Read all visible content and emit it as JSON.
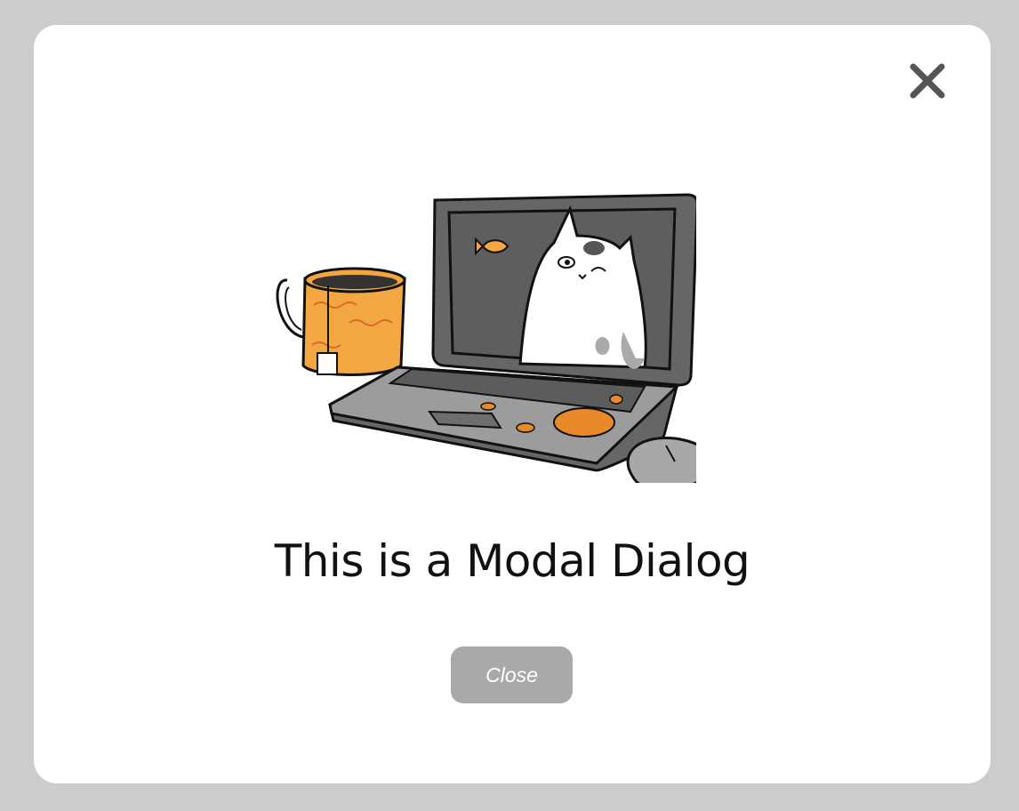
{
  "modal": {
    "title": "This is a Modal Dialog",
    "close_button_label": "Close"
  },
  "icons": {
    "close": "close-icon",
    "illustration": "laptop-cat-illustration"
  },
  "colors": {
    "overlay": "#cccccc",
    "modal_background": "#ffffff",
    "button_background": "#a9a9a9",
    "button_text": "#ffffff",
    "close_icon": "#555555",
    "accent_orange": "#f0a040"
  }
}
